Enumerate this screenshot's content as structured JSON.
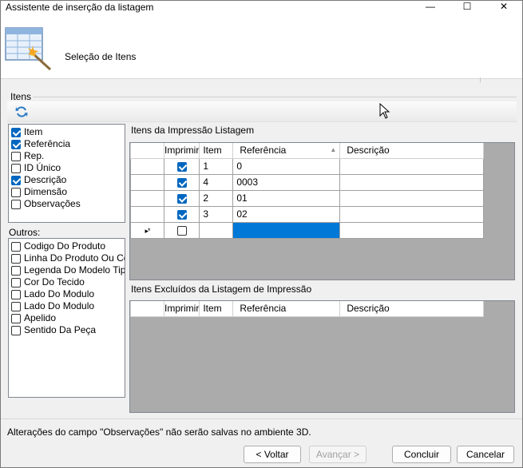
{
  "window": {
    "title": "Assistente de inserção da listagem",
    "minimize_glyph": "—",
    "maximize_glyph": "☐",
    "close_glyph": "✕"
  },
  "header": {
    "title": "Seleção de Itens",
    "icon": "table-wand-icon"
  },
  "group": {
    "label": "Itens"
  },
  "fields": [
    {
      "label": "Item",
      "checked": true
    },
    {
      "label": "Referência",
      "checked": true
    },
    {
      "label": "Rep.",
      "checked": false
    },
    {
      "label": "ID Único",
      "checked": false
    },
    {
      "label": "Descrição",
      "checked": true
    },
    {
      "label": "Dimensão",
      "checked": false
    },
    {
      "label": "Observações",
      "checked": false
    }
  ],
  "outros": {
    "label": "Outros:",
    "items": [
      {
        "label": "Codigo Do Produto",
        "checked": false
      },
      {
        "label": "Linha Do Produto Ou Coc",
        "checked": false
      },
      {
        "label": "Legenda Do Modelo Tipo",
        "checked": false
      },
      {
        "label": "Cor Do Tecido",
        "checked": false
      },
      {
        "label": "Lado Do Modulo",
        "checked": false
      },
      {
        "label": "Lado Do Modulo",
        "checked": false
      },
      {
        "label": "Apelido",
        "checked": false
      },
      {
        "label": "Sentido Da Peça",
        "checked": false
      }
    ]
  },
  "included_grid": {
    "label": "Itens da Impressão Listagem",
    "columns": [
      "Imprimir",
      "Item",
      "Referência",
      "Descrição"
    ],
    "sort_glyph": "▲",
    "rows": [
      {
        "imprimir": true,
        "item": "1",
        "referencia": "0",
        "descricao": ""
      },
      {
        "imprimir": true,
        "item": "4",
        "referencia": "0003",
        "descricao": ""
      },
      {
        "imprimir": true,
        "item": "2",
        "referencia": "01",
        "descricao": ""
      },
      {
        "imprimir": true,
        "item": "3",
        "referencia": "02",
        "descricao": ""
      }
    ],
    "new_row_glyph": "▸*"
  },
  "excluded_grid": {
    "label": "Itens Excluídos da Listagem de Impressão",
    "columns": [
      "Imprimir",
      "Item",
      "Referência",
      "Descrição"
    ]
  },
  "status": {
    "text": "Alterações do campo \"Observações\" não serão salvas no ambiente 3D."
  },
  "buttons": {
    "back": "< Voltar",
    "next": "Avançar >",
    "finish": "Concluir",
    "cancel": "Cancelar"
  }
}
